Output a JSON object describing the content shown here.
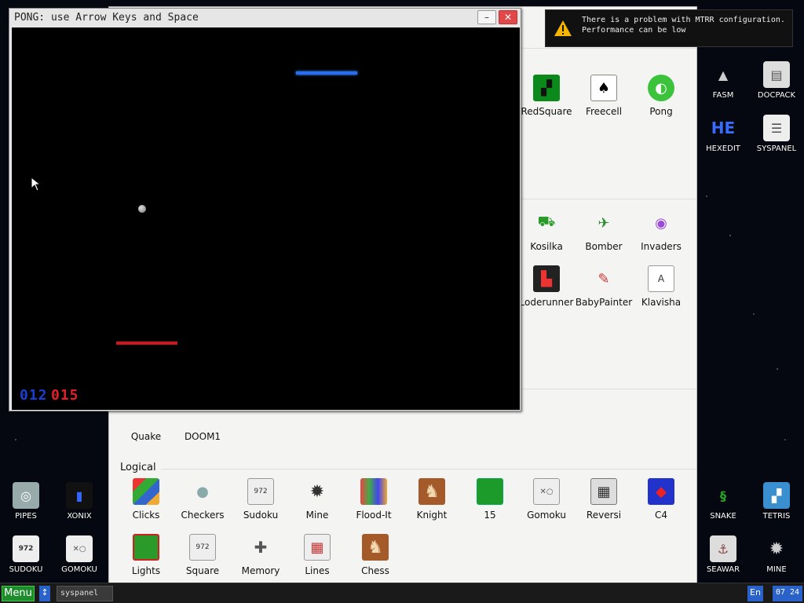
{
  "pong": {
    "title": "PONG: use Arrow Keys and Space",
    "minimize": "–",
    "close": "✕",
    "score_blue": "012",
    "score_red": "015"
  },
  "notification": {
    "line1": "There is a problem with MTRR configuration.",
    "line2": "Performance can be low"
  },
  "menu": {
    "games_row1": [
      "RedSquare",
      "Freecell",
      "Pong"
    ],
    "games_row2": [
      "Kosilka",
      "Bomber",
      "Invaders"
    ],
    "games_row3": [
      "Loderunner",
      "BabyPainter",
      "Klavisha"
    ],
    "shooters": [
      "Quake",
      "DOOM1"
    ],
    "logical_label": "Logical",
    "logical_row1": [
      "Clicks",
      "Checkers",
      "Sudoku",
      "Mine",
      "Flood-It",
      "Knight",
      "15",
      "Gomoku",
      "Reversi",
      "C4"
    ],
    "logical_row2": [
      "Lights",
      "Square",
      "Memory",
      "Lines",
      "Chess"
    ]
  },
  "desktop": {
    "right": [
      "FASM",
      "DOCPACK",
      "HEXEDIT",
      "SYSPANEL",
      "SNAKE",
      "TETRIS",
      "SEAWAR",
      "MINE"
    ],
    "left": [
      "PIPES",
      "XONIX",
      "SUDOKU",
      "GOMOKU"
    ]
  },
  "taskbar": {
    "menu": "Menu",
    "arrow": "↕",
    "task": "syspanel",
    "lang": "En",
    "clock": "07 24"
  }
}
